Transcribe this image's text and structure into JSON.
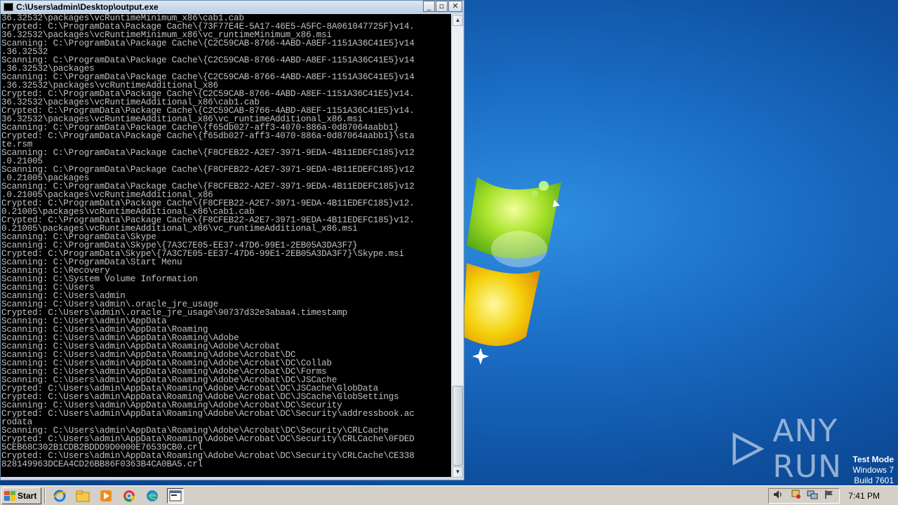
{
  "window": {
    "title": "C:\\Users\\admin\\Desktop\\output.exe",
    "minimize_label": "_",
    "maximize_label": "▫",
    "close_label": "✕"
  },
  "console_lines": [
    "36.32532\\packages\\vcRuntimeMinimum_x86\\cab1.cab",
    "Crypted: C:\\ProgramData\\Package Cache\\{73F77E4E-5A17-46E5-A5FC-8A061047725F}v14.",
    "36.32532\\packages\\vcRuntimeMinimum_x86\\vc_runtimeMinimum_x86.msi",
    "Scanning: C:\\ProgramData\\Package Cache\\{C2C59CAB-8766-4ABD-A8EF-1151A36C41E5}v14",
    ".36.32532",
    "Scanning: C:\\ProgramData\\Package Cache\\{C2C59CAB-8766-4ABD-A8EF-1151A36C41E5}v14",
    ".36.32532\\packages",
    "Scanning: C:\\ProgramData\\Package Cache\\{C2C59CAB-8766-4ABD-A8EF-1151A36C41E5}v14",
    ".36.32532\\packages\\vcRuntimeAdditional_x86",
    "Crypted: C:\\ProgramData\\Package Cache\\{C2C59CAB-8766-4ABD-A8EF-1151A36C41E5}v14.",
    "36.32532\\packages\\vcRuntimeAdditional_x86\\cab1.cab",
    "Crypted: C:\\ProgramData\\Package Cache\\{C2C59CAB-8766-4ABD-A8EF-1151A36C41E5}v14.",
    "36.32532\\packages\\vcRuntimeAdditional_x86\\vc_runtimeAdditional_x86.msi",
    "Scanning: C:\\ProgramData\\Package Cache\\{f65db027-aff3-4070-886a-0d87064aabb1}",
    "Crypted: C:\\ProgramData\\Package Cache\\{f65db027-aff3-4070-886a-0d87064aabb1}\\sta",
    "te.rsm",
    "Scanning: C:\\ProgramData\\Package Cache\\{F8CFEB22-A2E7-3971-9EDA-4B11EDEFC185}v12",
    ".0.21005",
    "Scanning: C:\\ProgramData\\Package Cache\\{F8CFEB22-A2E7-3971-9EDA-4B11EDEFC185}v12",
    ".0.21005\\packages",
    "Scanning: C:\\ProgramData\\Package Cache\\{F8CFEB22-A2E7-3971-9EDA-4B11EDEFC185}v12",
    ".0.21005\\packages\\vcRuntimeAdditional_x86",
    "Crypted: C:\\ProgramData\\Package Cache\\{F8CFEB22-A2E7-3971-9EDA-4B11EDEFC185}v12.",
    "0.21005\\packages\\vcRuntimeAdditional_x86\\cab1.cab",
    "Crypted: C:\\ProgramData\\Package Cache\\{F8CFEB22-A2E7-3971-9EDA-4B11EDEFC185}v12.",
    "0.21005\\packages\\vcRuntimeAdditional_x86\\vc_runtimeAdditional_x86.msi",
    "Scanning: C:\\ProgramData\\Skype",
    "Scanning: C:\\ProgramData\\Skype\\{7A3C7E05-EE37-47D6-99E1-2EB05A3DA3F7}",
    "Crypted: C:\\ProgramData\\Skype\\{7A3C7E05-EE37-47D6-99E1-2EB05A3DA3F7}\\Skype.msi",
    "Scanning: C:\\ProgramData\\Start Menu",
    "Scanning: C:\\Recovery",
    "Scanning: C:\\System Volume Information",
    "Scanning: C:\\Users",
    "Scanning: C:\\Users\\admin",
    "Scanning: C:\\Users\\admin\\.oracle_jre_usage",
    "Crypted: C:\\Users\\admin\\.oracle_jre_usage\\90737d32e3abaa4.timestamp",
    "Scanning: C:\\Users\\admin\\AppData",
    "Scanning: C:\\Users\\admin\\AppData\\Roaming",
    "Scanning: C:\\Users\\admin\\AppData\\Roaming\\Adobe",
    "Scanning: C:\\Users\\admin\\AppData\\Roaming\\Adobe\\Acrobat",
    "Scanning: C:\\Users\\admin\\AppData\\Roaming\\Adobe\\Acrobat\\DC",
    "Scanning: C:\\Users\\admin\\AppData\\Roaming\\Adobe\\Acrobat\\DC\\Collab",
    "Scanning: C:\\Users\\admin\\AppData\\Roaming\\Adobe\\Acrobat\\DC\\Forms",
    "Scanning: C:\\Users\\admin\\AppData\\Roaming\\Adobe\\Acrobat\\DC\\JSCache",
    "Crypted: C:\\Users\\admin\\AppData\\Roaming\\Adobe\\Acrobat\\DC\\JSCache\\GlobData",
    "Crypted: C:\\Users\\admin\\AppData\\Roaming\\Adobe\\Acrobat\\DC\\JSCache\\GlobSettings",
    "Scanning: C:\\Users\\admin\\AppData\\Roaming\\Adobe\\Acrobat\\DC\\Security",
    "Crypted: C:\\Users\\admin\\AppData\\Roaming\\Adobe\\Acrobat\\DC\\Security\\addressbook.ac",
    "rodata",
    "Scanning: C:\\Users\\admin\\AppData\\Roaming\\Adobe\\Acrobat\\DC\\Security\\CRLCache",
    "Crypted: C:\\Users\\admin\\AppData\\Roaming\\Adobe\\Acrobat\\DC\\Security\\CRLCache\\0FDED",
    "5CEB68C302B1CDB2BDDD9D0000E76539CB0.crl",
    "Crypted: C:\\Users\\admin\\AppData\\Roaming\\Adobe\\Acrobat\\DC\\Security\\CRLCache\\CE338",
    "828149963DCEA4CD26BB86F0363B4CA0BA5.crl"
  ],
  "desktop": {
    "watermark_text": "ANY RUN",
    "test_mode_line1": "Test Mode",
    "test_mode_line2": "Windows 7",
    "test_mode_line3": "Build 7601"
  },
  "taskbar": {
    "start_label": "Start",
    "clock": "7:41 PM",
    "pinned": [
      "ie-icon",
      "explorer-icon",
      "media-player-icon",
      "chrome-icon",
      "edge-icon",
      "console-icon"
    ]
  },
  "colors": {
    "console_bg": "#000000",
    "console_text": "#c0c0c0",
    "desktop_blue": "#1a6cc4",
    "taskbar": "#d4d0c8"
  }
}
